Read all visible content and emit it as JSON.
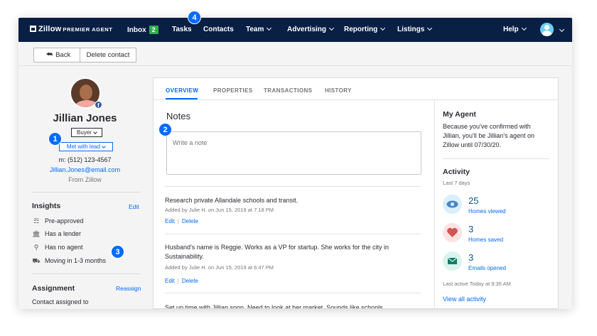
{
  "nav": {
    "logo_text": "Zillow",
    "logo_sub": "PREMIER AGENT",
    "inbox_label": "Inbox",
    "inbox_count": "2",
    "tasks_label": "Tasks",
    "contacts_label": "Contacts",
    "team_label": "Team",
    "advertising_label": "Advertising",
    "reporting_label": "Reporting",
    "listings_label": "Listings",
    "help_label": "Help"
  },
  "toolbar": {
    "back_label": "Back",
    "delete_label": "Delete contact"
  },
  "contact": {
    "name": "Jillian Jones",
    "type": "Buyer",
    "status": "Met with lead",
    "phone": "m: (512) 123-4567",
    "email": "Jillian.Jones@email.com",
    "source": "From Zillow"
  },
  "insights": {
    "title": "Insights",
    "edit_label": "Edit",
    "items": [
      {
        "icon": "dollar-check-icon",
        "label": "Pre-approved"
      },
      {
        "icon": "bank-icon",
        "label": "Has a lender"
      },
      {
        "icon": "person-icon",
        "label": "Has no agent"
      },
      {
        "icon": "truck-icon",
        "label": "Moving in 1-3 months"
      }
    ]
  },
  "assignment": {
    "title": "Assignment",
    "reassign_label": "Reassign",
    "text": "Contact assigned to"
  },
  "tabs": [
    "OVERVIEW",
    "PROPERTIES",
    "TRANSACTIONS",
    "HISTORY"
  ],
  "notes": {
    "title": "Notes",
    "placeholder": "Write a note",
    "edit_label": "Edit",
    "delete_label": "Delete",
    "sep": "|",
    "items": [
      {
        "text": "Research private Allandale schools and transit.",
        "meta": "Added by Julie H. on Jun 15, 2019 at 7:18 PM"
      },
      {
        "text": "Husband's name is Reggie. Works as a VP for startup. She works for the city in Sustainability.",
        "meta": "Added by Julie H. on Jun 15, 2019 at 6:47 PM"
      },
      {
        "text": "Set up time with Jillian soon. Need to look at her market. Sounds like schools",
        "meta": ""
      }
    ]
  },
  "my_agent": {
    "title": "My Agent",
    "text": "Because you've confirmed with Jillian, you'll be Jillian's agent on Zillow until 07/30/20."
  },
  "activity": {
    "title": "Activity",
    "period": "Last 7 days",
    "stats": [
      {
        "value": "25",
        "label": "Homes viewed",
        "icon": "eye-icon",
        "color": "#dbeefb"
      },
      {
        "value": "3",
        "label": "Homes saved",
        "icon": "heart-icon",
        "color": "#fde3e3"
      },
      {
        "value": "3",
        "label": "Emails opened",
        "icon": "envelope-icon",
        "color": "#dcf3ee"
      }
    ],
    "last_active": "Last active Today at 9:35 AM",
    "view_all_label": "View all activity"
  },
  "callouts": [
    "1",
    "2",
    "3",
    "4"
  ]
}
